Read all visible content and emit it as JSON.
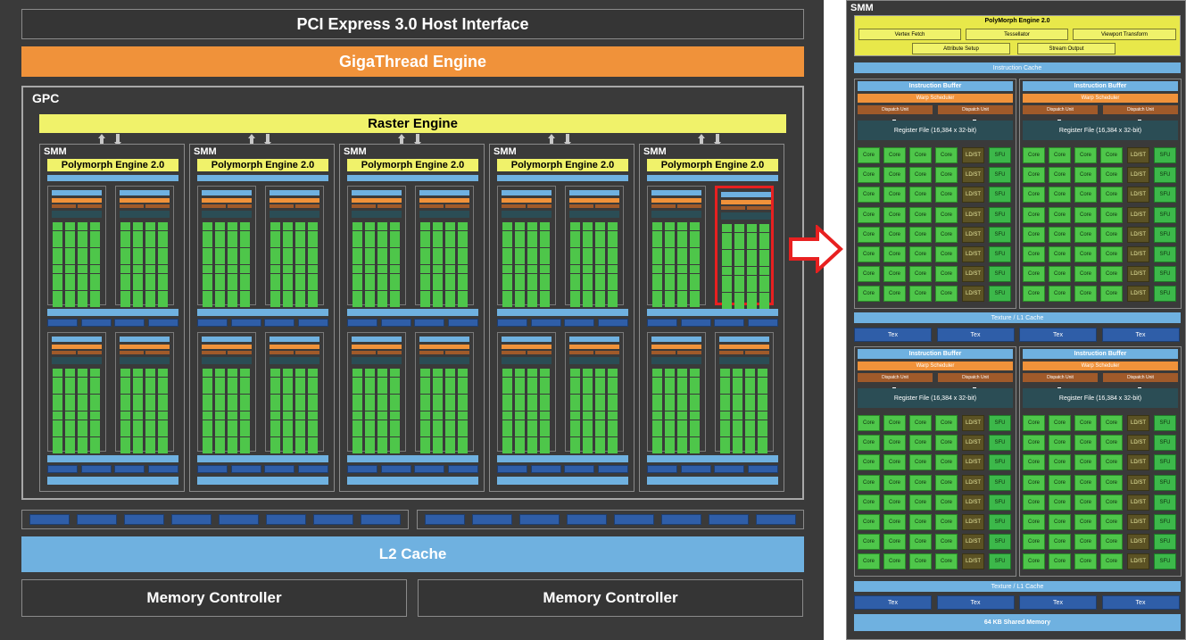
{
  "chip": {
    "host_interface": "PCI Express 3.0 Host Interface",
    "giga_thread": "GigaThread Engine",
    "gpc_label": "GPC",
    "raster_engine": "Raster Engine",
    "smm_label": "SMM",
    "polymorph": "Polymorph Engine 2.0",
    "l2_cache": "L2 Cache",
    "memory_controller_left": "Memory Controller",
    "memory_controller_right": "Memory Controller"
  },
  "detail": {
    "smm_label": "SMM",
    "polymorph_title": "PolyMorph Engine 2.0",
    "polymorph_units": [
      "Vertex Fetch",
      "Tessellator",
      "Viewport Transform",
      "Attribute Setup",
      "Stream Output"
    ],
    "instruction_cache": "Instruction Cache",
    "instruction_buffer": "Instruction Buffer",
    "warp_scheduler": "Warp Scheduler",
    "dispatch_unit": "Dispatch Unit",
    "register_file": "Register File (16,384 x 32-bit)",
    "core": "Core",
    "ldst": "LD/ST",
    "sfu": "SFU",
    "texture_l1": "Texture / L1 Cache",
    "tex": "Tex",
    "shared_memory": "64 KB Shared Memory"
  },
  "colors": {
    "background": "#3a3a3a",
    "accent_orange": "#f0923a",
    "accent_yellow": "#f0f26a",
    "cache_blue": "#6fb1e0",
    "core_green": "#4ec64a",
    "highlight_red": "#e82020"
  }
}
